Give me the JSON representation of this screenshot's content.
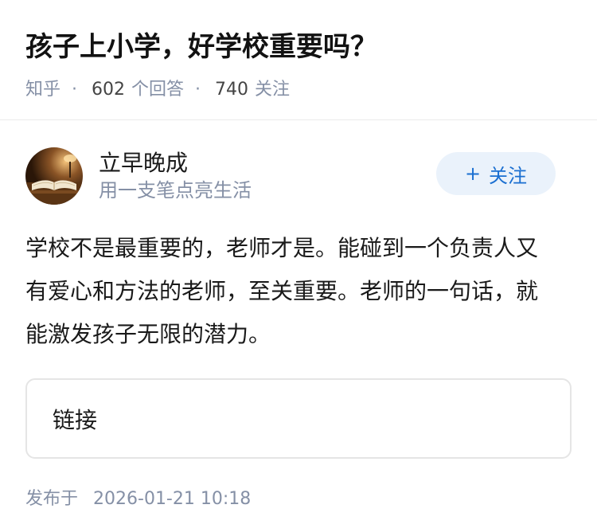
{
  "question": {
    "title": "孩子上小学，好学校重要吗？",
    "source": "知乎",
    "answer_count": "602",
    "answer_unit": "个回答",
    "follow_count": "740",
    "follow_unit": "关注",
    "separator": "·"
  },
  "answer": {
    "author_name": "立早晚成",
    "author_bio": "用一支笔点亮生活",
    "follow_button": {
      "icon": "+",
      "label": "关注"
    },
    "content": "学校不是最重要的，老师才是。能碰到一个负责人又有爱心和方法的老师，至关重要。老师的一句话，就能激发孩子无限的潜力。",
    "link_card_label": "链接",
    "publish_label": "发布于",
    "publish_time": "2026-01-21 10:18"
  },
  "colors": {
    "accent": "#1a6fd1",
    "meta_gray": "#8590a6",
    "follow_bg": "#eaf2fb"
  }
}
